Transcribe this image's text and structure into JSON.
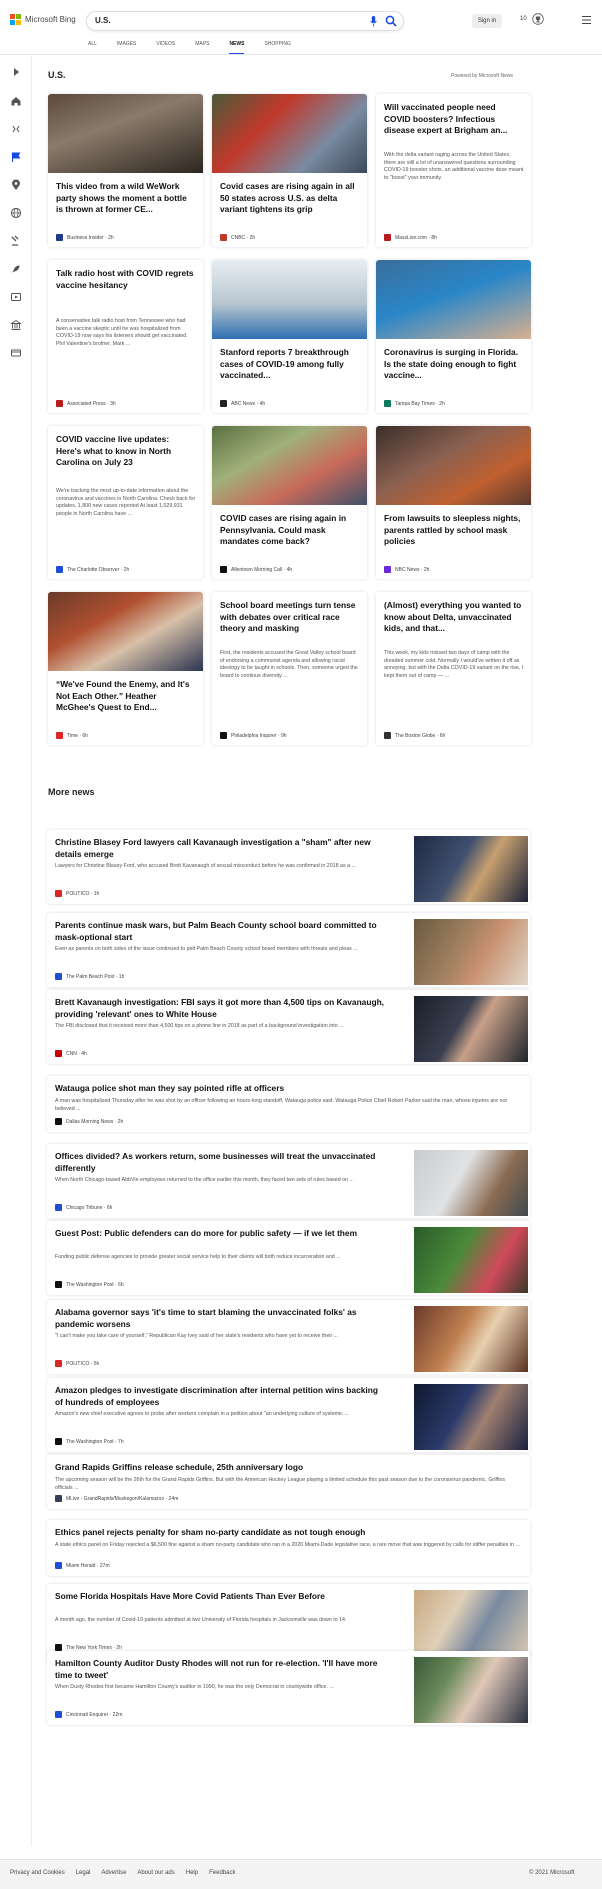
{
  "header": {
    "logo_text": "Microsoft Bing",
    "query": "U.S.",
    "signin": "Sign in",
    "points": "10"
  },
  "tabs": [
    {
      "label": "ALL"
    },
    {
      "label": "IMAGES"
    },
    {
      "label": "VIDEOS"
    },
    {
      "label": "MAPS"
    },
    {
      "label": "NEWS"
    },
    {
      "label": "SHOPPING"
    }
  ],
  "section_title": "U.S.",
  "powered": "Powered by Microsoft News",
  "more_title": "More news",
  "cards": [
    {
      "title": "This video from a wild WeWork party shows the moment a bottle is thrown at former CE...",
      "snippet": "",
      "source": "Business Insider · 2h",
      "color": "#1e3a8a"
    },
    {
      "title": "Covid cases are rising again in all 50 states across U.S. as delta variant tightens its grip",
      "snippet": "",
      "source": "CNBC · 2h",
      "color": "#c0392b"
    },
    {
      "title": "Will vaccinated people need COVID boosters? Infectious disease expert at Brigham an...",
      "snippet": "With the delta variant raging across the United States, there are still a lot of unanswered questions surrounding COVID-19 booster shots, an additional vaccine dose meant to \"boost\" your immunity.",
      "source": "MassLive.com · 8h",
      "color": "#b91c1c"
    },
    {
      "title": "Talk radio host with COVID regrets vaccine hesitancy",
      "snippet": "A conservative talk radio host from Tennessee who had been a vaccine skeptic until he was hospitalized from COVID-19 now says his listeners should get vaccinated. Phil Valentine's brother, Mark ...",
      "source": "Associated Press · 3h",
      "color": "#b91c1c"
    },
    {
      "title": "Stanford reports 7 breakthrough cases of COVID-19 among fully vaccinated...",
      "snippet": "",
      "source": "ABC News · 4h",
      "color": "#222"
    },
    {
      "title": "Coronavirus is surging in Florida. Is the state doing enough to fight vaccine...",
      "snippet": "",
      "source": "Tampa Bay Times · 2h",
      "color": "#0d7a5f"
    },
    {
      "title": "COVID vaccine live updates: Here's what to know in North Carolina on July 23",
      "snippet": "We're tracking the most up-to-date information about the coronavirus and vaccines in North Carolina. Check back for updates. 1,800 new cases reported At least 1,029,931 people in North Carolina have ...",
      "source": "The Charlotte Observer · 2h",
      "color": "#1d4ed8"
    },
    {
      "title": "COVID cases are rising again in Pennsylvania. Could mask mandates come back?",
      "snippet": "",
      "source": "Allentown Morning Call · 4h",
      "color": "#111"
    },
    {
      "title": "From lawsuits to sleepless nights, parents rattled by school mask policies",
      "snippet": "",
      "source": "NBC News · 2h",
      "color": "#6d28d9"
    },
    {
      "title": "“We've Found the Enemy, and It's Not Each Other.” Heather McGhee's Quest to End...",
      "snippet": "",
      "source": "Time · 6h",
      "color": "#dc2626"
    },
    {
      "title": "School board meetings turn tense with debates over critical race theory and masking",
      "snippet": "First, the residents accused the Great Valley school board of endorsing a communist agenda and allowing racist ideology to be taught in schools. Then, someone urged the board to continue diversity ...",
      "source": "Philadelphia Inquirer · 9h",
      "color": "#111"
    },
    {
      "title": "(Almost) everything you wanted to know about Delta, unvaccinated kids, and that...",
      "snippet": "This week, my kids missed two days of camp with the dreaded summer cold. Normally I would've written it off as annoying, but with the Delta COVID-19 variant on the rise, I kept them out of camp — ...",
      "source": "The Boston Globe · 6h",
      "color": "#333"
    }
  ],
  "more": [
    {
      "title": "Christine Blasey Ford lawyers call Kavanaugh investigation a \"sham\" after new details emerge",
      "snippet": "Lawyers for Christine Blasey Ford, who accused Brett Kavanaugh of sexual misconduct before he was confirmed in 2018 as a ...",
      "source": "POLITICO · 1h",
      "color": "#dc2626"
    },
    {
      "title": "Parents continue mask wars, but Palm Beach County school board committed to mask-optional start",
      "snippet": "Even as parents on both sides of the issue continued to pelt Palm Beach County school board members with threats and pleas ...",
      "source": "The Palm Beach Post · 1h",
      "color": "#1d4ed8"
    },
    {
      "title": "Brett Kavanaugh investigation: FBI says it got more than 4,500 tips on Kavanaugh, providing 'relevant' ones to White House",
      "snippet": "The FBI disclosed that it received more than 4,500 tips on a phone line in 2018 as part of a background investigation into ...",
      "source": "CNN · 4h",
      "color": "#cc0000"
    },
    {
      "title": "Watauga police shot man they say pointed rifle at officers",
      "snippet": "A man was hospitalized Thursday after he was shot by an officer following an hours-long standoff, Watauga police said. Watauga Police Chief Robert Parker said the man, whose injuries are not believed ...",
      "source": "Dallas Morning News · 2h",
      "color": "#111"
    },
    {
      "title": "Offices divided? As workers return, some businesses will treat the unvaccinated differently",
      "snippet": "When North Chicago-based AbbVie employees returned to the office earlier this month, they faced two sets of rules based on ...",
      "source": "Chicago Tribune · 6h",
      "color": "#1d4ed8"
    },
    {
      "title": "Guest Post: Public defenders can do more for public safety — if we let them",
      "snippet": "Funding public defense agencies to provide greater social service help to their clients will both reduce incarceration and ...",
      "source": "The Washington Post · 6h",
      "color": "#111"
    },
    {
      "title": "Alabama governor says 'it's time to start blaming the unvaccinated folks' as pandemic worsens",
      "snippet": "\"I can't make you take care of yourself,\" Republican Kay Ivey said of her state's residents who have yet to receive their ...",
      "source": "POLITICO · 5h",
      "color": "#dc2626"
    },
    {
      "title": "Amazon pledges to investigate discrimination after internal petition wins backing of hundreds of employees",
      "snippet": "Amazon's new chief executive agrees to probe after workers complain in a petition about \"an underlying culture of systemic ...",
      "source": "The Washington Post · 7h",
      "color": "#111"
    },
    {
      "title": "Grand Rapids Griffins release schedule, 25th anniversary logo",
      "snippet": "The upcoming season will be the 26th for the Grand Rapids Griffins. But with the American Hockey League playing a limited schedule this past season due to the coronavirus pandemic, Griffins officials ...",
      "source": "MLive - GrandRapids/Muskegon/Kalamazoo · 24m",
      "color": "#334155"
    },
    {
      "title": "Ethics panel rejects penalty for sham no-party candidate as not tough enough",
      "snippet": "A state ethics panel on Friday rejected a $6,500 fine against a sham no-party candidate who ran in a 2020 Miami-Dade legislative race, a rare move that was triggered by calls for stiffer penalties in ...",
      "source": "Miami Herald · 27m",
      "color": "#1d4ed8"
    },
    {
      "title": "Some Florida Hospitals Have More Covid Patients Than Ever Before",
      "snippet": "A month ago, the number of Covid-19 patients admitted at two University of Florida hospitals in Jacksonville was down to 14.",
      "source": "The New York Times · 2h",
      "color": "#111"
    },
    {
      "title": "Hamilton County Auditor Dusty Rhodes will not run for re-election. 'I'll have more time to tweet'",
      "snippet": "When Dusty Rhodes first became Hamilton County's auditor in 1990, he was the only Democrat in countywide office. ...",
      "source": "Cincinnati Enquirer · 22m",
      "color": "#1d4ed8"
    }
  ],
  "footer": {
    "links": [
      {
        "label": "Privacy and Cookies"
      },
      {
        "label": "Legal"
      },
      {
        "label": "Advertise"
      },
      {
        "label": "About our ads"
      },
      {
        "label": "Help"
      },
      {
        "label": "Feedback"
      }
    ],
    "copyright": "© 2021 Microsoft"
  }
}
